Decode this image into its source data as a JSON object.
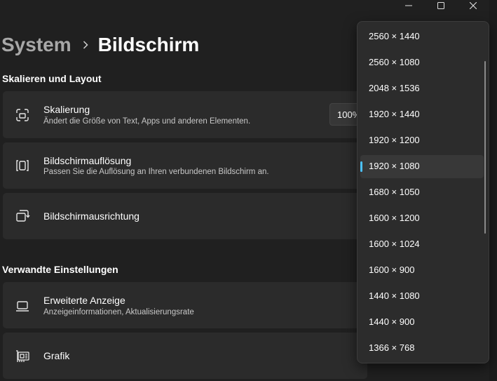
{
  "breadcrumb": {
    "parent": "System",
    "separator_icon": "chevron-right-icon",
    "current": "Bildschirm"
  },
  "window_controls": {
    "minimize_icon": "minimize-icon",
    "maximize_icon": "maximize-icon",
    "close_icon": "close-icon"
  },
  "sections": [
    {
      "title": "Skalieren und Layout",
      "cards": [
        {
          "icon": "scale-icon",
          "title": "Skalierung",
          "description": "Ändert die Größe von Text, Apps und anderen Elementen.",
          "value": "100%"
        },
        {
          "icon": "resolution-icon",
          "title": "Bildschirmauflösung",
          "description": "Passen Sie die Auflösung an Ihren verbundenen Bildschirm an."
        },
        {
          "icon": "orientation-icon",
          "title": "Bildschirmausrichtung"
        }
      ]
    },
    {
      "title": "Verwandte Einstellungen",
      "cards": [
        {
          "icon": "laptop-icon",
          "title": "Erweiterte Anzeige",
          "description": "Anzeigeinformationen, Aktualisierungsrate"
        },
        {
          "icon": "graphics-card-icon",
          "title": "Grafik"
        }
      ]
    }
  ],
  "resolution_dropdown": {
    "selected": "1920 × 1080",
    "options": [
      "2560 × 1440",
      "2560 × 1080",
      "2048 × 1536",
      "1920 × 1440",
      "1920 × 1200",
      "1920 × 1080",
      "1680 × 1050",
      "1600 × 1200",
      "1600 × 1024",
      "1600 × 900",
      "1440 × 1080",
      "1440 × 900",
      "1366 × 768"
    ],
    "accent_color": "#4cc2ff"
  },
  "colors": {
    "background": "#202020",
    "card": "#2b2b2b",
    "flyout": "#2c2c2c",
    "accent": "#4cc2ff"
  }
}
